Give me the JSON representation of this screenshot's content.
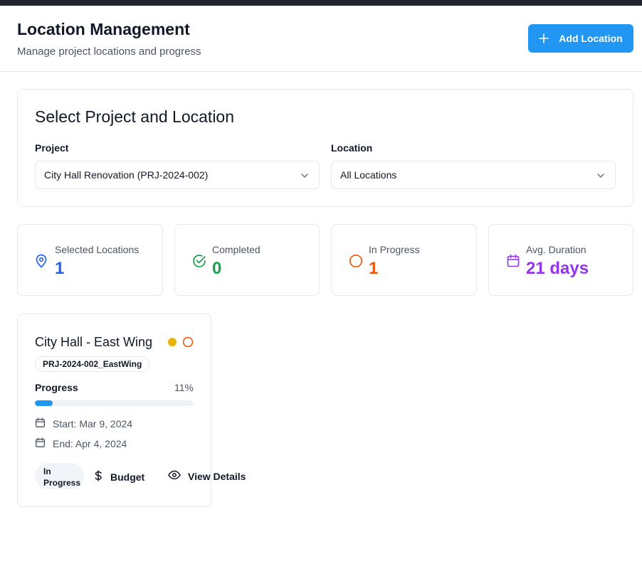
{
  "header": {
    "title": "Location Management",
    "subtitle": "Manage project locations and progress",
    "add_button_label": "Add Location"
  },
  "selection": {
    "title": "Select Project and Location",
    "project_label": "Project",
    "project_value": "City Hall Renovation (PRJ-2024-002)",
    "location_label": "Location",
    "location_value": "All Locations"
  },
  "stats": [
    {
      "label": "Selected Locations",
      "value": "1",
      "icon": "map-pin-icon",
      "color": "#2563eb"
    },
    {
      "label": "Completed",
      "value": "0",
      "icon": "check-circle-icon",
      "color": "#16a34a"
    },
    {
      "label": "In Progress",
      "value": "1",
      "icon": "circle-icon",
      "color": "#ea580c"
    },
    {
      "label": "Avg. Duration",
      "value": "21 days",
      "icon": "calendar-icon",
      "color": "#9333ea"
    }
  ],
  "locations": [
    {
      "name": "City Hall - East Wing",
      "code": "PRJ-2024-002_EastWing",
      "progress_label": "Progress",
      "progress_percent_text": "11%",
      "progress_fraction": 0.11,
      "start": "Start: Mar 9, 2024",
      "end": "End: Apr 4, 2024",
      "status_line1": "In",
      "status_line2": "Progress",
      "budget_label": "Budget",
      "view_details_label": "View Details",
      "indicator_dot_color": "#eab308",
      "indicator_ring_color": "#ea580c"
    }
  ],
  "colors": {
    "accent": "#2196f3",
    "topbar": "#1f2330"
  }
}
